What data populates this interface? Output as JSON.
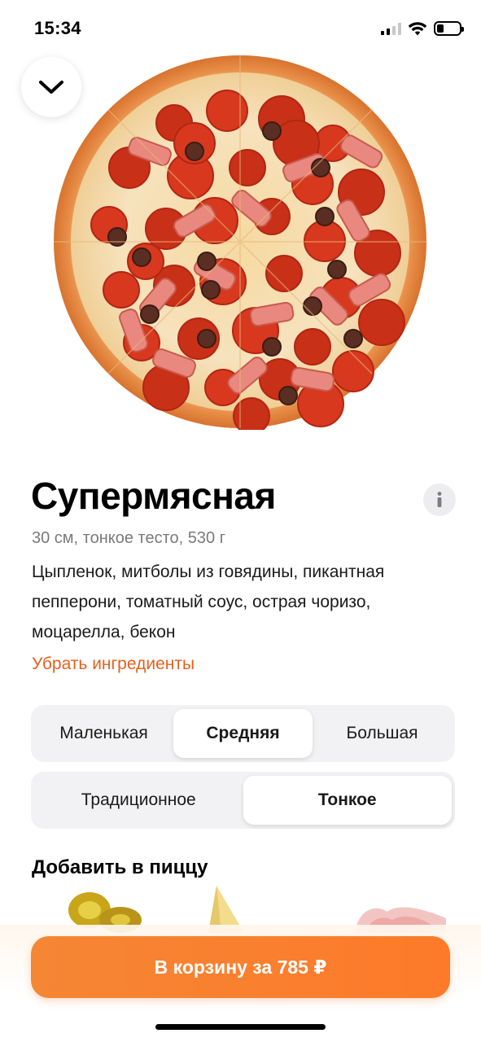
{
  "status_bar": {
    "time": "15:34",
    "icons": [
      "signal-icon",
      "wifi-icon",
      "battery-icon"
    ]
  },
  "nav": {
    "collapse_icon": "chevron-down-icon"
  },
  "product": {
    "image_icon": "pizza-image",
    "title": "Супермясная",
    "info_icon": "info-icon",
    "subtitle": "30 см, тонкое тесто, 530 г",
    "description": "Цыпленок, митболы из говядины, пикантная пепперони, томатный соус, острая чоризо, моцарелла, бекон",
    "remove_ingredients": "Убрать ингредиенты"
  },
  "size_options": {
    "items": [
      "Маленькая",
      "Средняя",
      "Большая"
    ],
    "selected": "Средняя"
  },
  "dough_options": {
    "items": [
      "Традиционное",
      "Тонкое"
    ],
    "selected": "Тонкое"
  },
  "addons": {
    "title": "Добавить в пиццу",
    "items": [
      "jalapeno-addon-icon",
      "cheese-addon-icon",
      "ham-addon-icon"
    ]
  },
  "cart": {
    "label": "В корзину за 785 ₽"
  },
  "colors": {
    "accent": "#ff6900",
    "cart_button": "#f98030",
    "link": "#e8601c",
    "segment_bg": "#f2f2f4"
  }
}
